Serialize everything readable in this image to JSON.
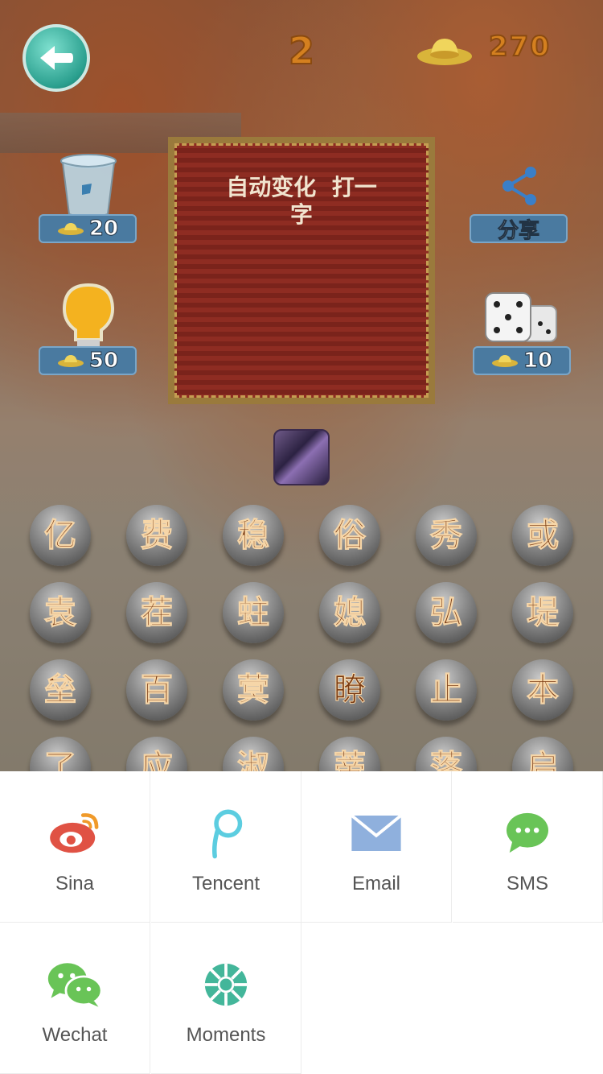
{
  "header": {
    "back_icon": "arrow-left-icon",
    "level": "2",
    "coins": "270"
  },
  "tools": {
    "trash": {
      "icon": "trash-icon",
      "price": "20"
    },
    "share": {
      "icon": "share-icon",
      "label": "分享"
    },
    "hint": {
      "icon": "lightbulb-icon",
      "price": "50"
    },
    "dice": {
      "icon": "dice-icon",
      "price": "10"
    }
  },
  "puzzle": {
    "clue_line1": "自动变化  打一",
    "clue_line2": "字"
  },
  "letters": [
    [
      "亿",
      "费",
      "稳",
      "俗",
      "秀",
      "或"
    ],
    [
      "袁",
      "茬",
      "蛀",
      "媳",
      "弘",
      "堤"
    ],
    [
      "垒",
      "百",
      "蓂",
      "瞭",
      "止",
      "本"
    ],
    [
      "了",
      "应",
      "淑",
      "蒂",
      "落",
      "启"
    ]
  ],
  "share_sheet": {
    "items": [
      {
        "label": "Sina",
        "icon": "weibo-icon",
        "color": "#e05244"
      },
      {
        "label": "Tencent",
        "icon": "tencent-weibo-icon",
        "color": "#5ccde0"
      },
      {
        "label": "Email",
        "icon": "mail-icon",
        "color": "#8fb0dd"
      },
      {
        "label": "SMS",
        "icon": "chat-bubble-icon",
        "color": "#69c457"
      },
      {
        "label": "Wechat",
        "icon": "wechat-icon",
        "color": "#69c457"
      },
      {
        "label": "Moments",
        "icon": "moments-icon",
        "color": "#43b69a"
      }
    ]
  }
}
